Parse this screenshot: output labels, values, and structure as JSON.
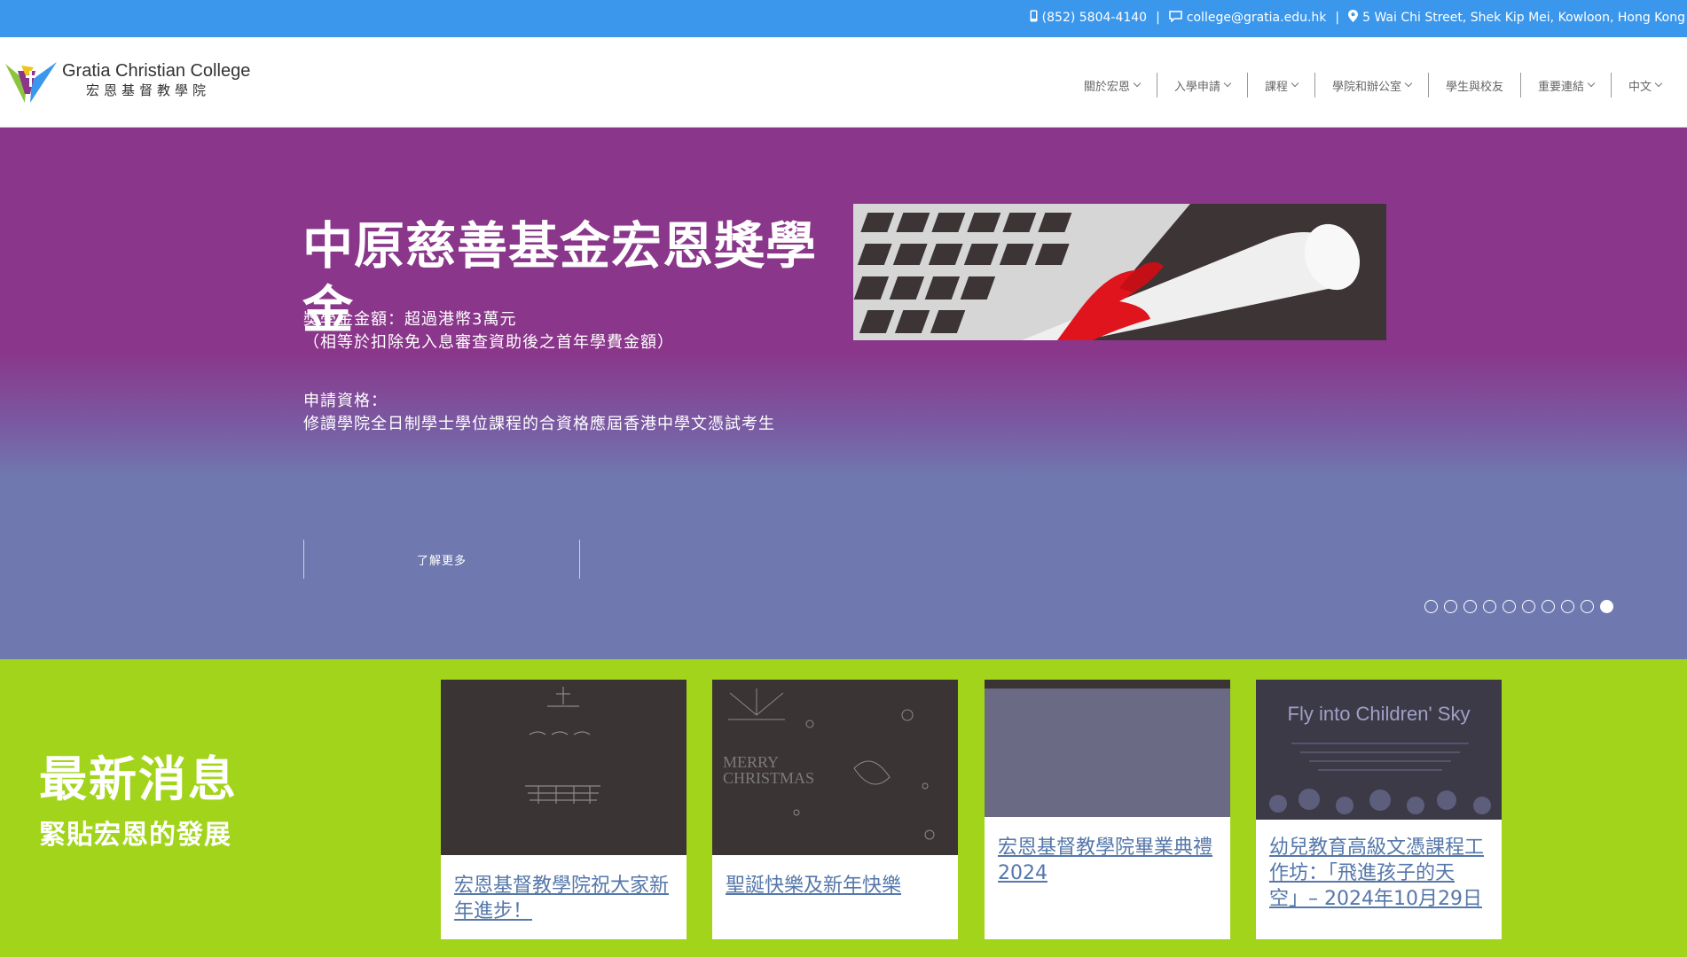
{
  "topbar": {
    "phone": "(852) 5804-4140",
    "email": "college@gratia.edu.hk",
    "address": "5 Wai Chi Street, Shek Kip Mei, Kowloon, Hong Kong",
    "separator": "|",
    "bg_color": "#3a97ec"
  },
  "logo": {
    "name_en": "Gratia Christian College",
    "name_zh": "宏恩基督教學院"
  },
  "nav": {
    "items": [
      {
        "label": "關於宏恩",
        "has_dropdown": true
      },
      {
        "label": "入學申請",
        "has_dropdown": true
      },
      {
        "label": "課程",
        "has_dropdown": true
      },
      {
        "label": "學院和辦公室",
        "has_dropdown": true
      },
      {
        "label": "學生與校友",
        "has_dropdown": false
      },
      {
        "label": "重要連結",
        "has_dropdown": true
      },
      {
        "label": "中文",
        "has_dropdown": true
      }
    ]
  },
  "hero": {
    "title": "中原慈善基金宏恩獎學金",
    "amount_line1": "獎學金金額：超過港幣3萬元",
    "amount_line2": "（相等於扣除免入息審查資助後之首年學費金額）",
    "eligibility_label": "申請資格：",
    "eligibility_text": "修讀學院全日制學士學位課程的合資格應屆香港中學文憑試考生",
    "button_label": "了解更多",
    "slide_count": 10,
    "active_slide": 10,
    "colors": {
      "top": "#8a368a",
      "bottom": "#6f79b0"
    }
  },
  "news": {
    "title": "最新消息",
    "subtitle": "緊貼宏恩的發展",
    "bg_color": "#a2d41c",
    "cards": [
      {
        "title": "宏恩基督教學院祝大家新年進步！"
      },
      {
        "title": "聖誕快樂及新年快樂",
        "image_text": [
          "MERRY",
          "CHRISTMAS"
        ]
      },
      {
        "title": "宏恩基督教學院畢業典禮 2024"
      },
      {
        "title": "幼兒教育高級文憑課程工作坊：「飛進孩子的天空」– 2024年10月29日",
        "image_text": [
          "Fly into Children' Sky"
        ]
      }
    ]
  }
}
